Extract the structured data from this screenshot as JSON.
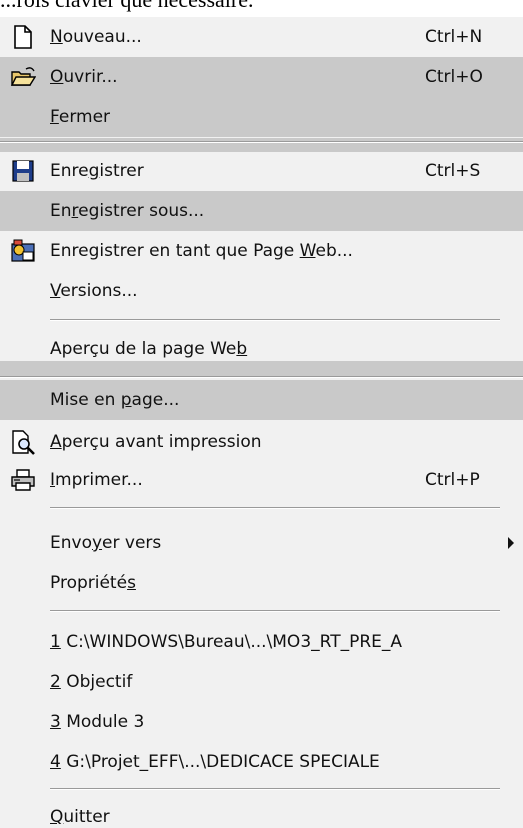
{
  "page_text_fragment": "...rois clavier que nécessaire.",
  "menu": {
    "items": [
      {
        "pre": "",
        "key": "N",
        "post": "ouveau...",
        "shortcut": "Ctrl+N",
        "icon": "new-document-icon"
      },
      {
        "pre": "",
        "key": "O",
        "post": "uvrir...",
        "shortcut": "Ctrl+O",
        "icon": "open-folder-icon"
      },
      {
        "pre": "",
        "key": "F",
        "post": "ermer",
        "shortcut": "",
        "icon": ""
      },
      {
        "pre": "Enre",
        "key": "g",
        "post": "istrer",
        "shortcut": "Ctrl+S",
        "icon": "save-disk-icon"
      },
      {
        "pre": "En",
        "key": "r",
        "post": "egistrer sous...",
        "shortcut": "",
        "icon": ""
      },
      {
        "pre": "Enregistrer en tant que Page ",
        "key": "W",
        "post": "eb...",
        "shortcut": "",
        "icon": "save-web-page-icon"
      },
      {
        "pre": "",
        "key": "V",
        "post": "ersions...",
        "shortcut": "",
        "icon": ""
      },
      {
        "pre": "Aperçu de la page We",
        "key": "b",
        "post": "",
        "shortcut": "",
        "icon": ""
      },
      {
        "pre": "Mise en ",
        "key": "p",
        "post": "age...",
        "shortcut": "",
        "icon": ""
      },
      {
        "pre": "",
        "key": "A",
        "post": "perçu avant impression",
        "shortcut": "",
        "icon": "print-preview-icon"
      },
      {
        "pre": "",
        "key": "I",
        "post": "mprimer...",
        "shortcut": "Ctrl+P",
        "icon": "printer-icon"
      },
      {
        "pre": "Envo",
        "key": "y",
        "post": "er vers",
        "shortcut": "",
        "icon": "",
        "submenu": true
      },
      {
        "pre": "Propriété",
        "key": "s",
        "post": "",
        "shortcut": "",
        "icon": ""
      },
      {
        "pre": "",
        "key": "1",
        "post": " C:\\WINDOWS\\Bureau\\...\\MO3_RT_PRE_A",
        "shortcut": "",
        "icon": ""
      },
      {
        "pre": "",
        "key": "2",
        "post": " Objectif",
        "shortcut": "",
        "icon": ""
      },
      {
        "pre": "",
        "key": "3",
        "post": " Module 3",
        "shortcut": "",
        "icon": ""
      },
      {
        "pre": "",
        "key": "4",
        "post": " G:\\Projet_EFF\\...\\DEDICACE SPECIALE",
        "shortcut": "",
        "icon": ""
      },
      {
        "pre": "",
        "key": "Q",
        "post": "uitter",
        "shortcut": "",
        "icon": ""
      }
    ]
  },
  "colors": {
    "menu_background": "#f1f1f1",
    "highlight": "#c9c9c9",
    "separator": "#9a9a9a"
  }
}
